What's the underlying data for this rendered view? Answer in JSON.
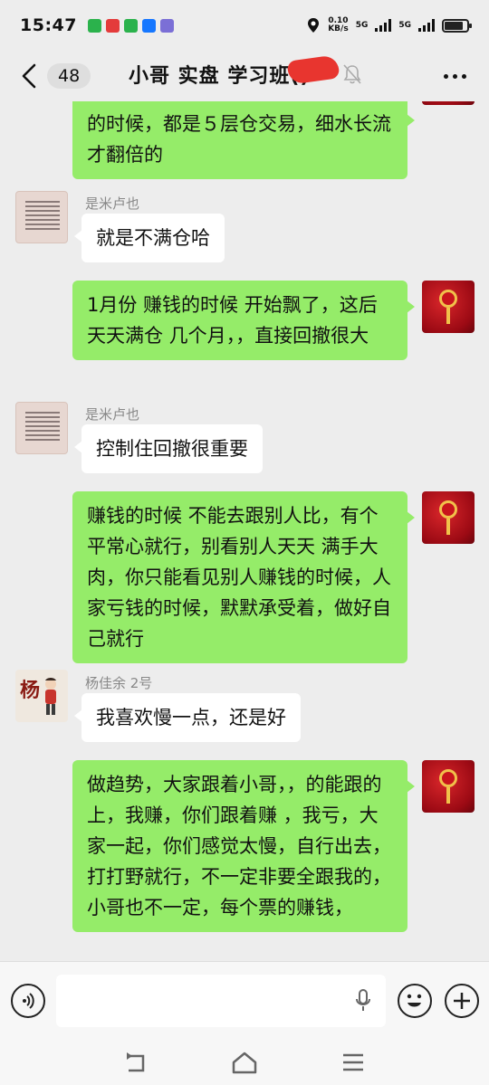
{
  "status_bar": {
    "time": "15:47",
    "speed_value": "0.10",
    "speed_unit": "KB/s",
    "net1": "5G",
    "net2": "5G",
    "battery_level": 0.85
  },
  "header": {
    "unread_count": "48",
    "title": "小哥 实盘 学习班(",
    "title_tail": ")"
  },
  "messages": [
    {
      "id": "m1",
      "side": "right",
      "text": "的时候，都是５层仓交易，细水长流 才翻倍的"
    },
    {
      "id": "m2",
      "side": "left",
      "sender": "是米卢也",
      "text": "就是不满仓哈"
    },
    {
      "id": "m3",
      "side": "right",
      "text": "1月份 赚钱的时候 开始飘了，这后天天满仓 几个月，，直接回撤很大"
    },
    {
      "id": "m4",
      "side": "left",
      "sender": "是米卢也",
      "text": "控制住回撤很重要"
    },
    {
      "id": "m5",
      "side": "right",
      "text": "赚钱的时候 不能去跟别人比，有个平常心就行，别看别人天天 满手大肉，你只能看见别人赚钱的时候，人家亏钱的时候，默默承受着，做好自己就行"
    },
    {
      "id": "m6",
      "side": "left",
      "sender": "杨佳余 2号",
      "text": "我喜欢慢一点，还是好"
    },
    {
      "id": "m7",
      "side": "right",
      "text": "做趋势，大家跟着小哥，，的能跟的上，我赚，你们跟着赚 ，我亏，大家一起，你们感觉太慢，自行出去，打打野就行，不一定非要全跟我的，小哥也不一定，每个票的赚钱，"
    }
  ],
  "avatars": {
    "yang_char": "杨"
  },
  "input": {
    "placeholder": ""
  },
  "colors": {
    "bubble_self": "#95ec69",
    "bubble_other": "#ffffff",
    "background": "#ededed"
  }
}
